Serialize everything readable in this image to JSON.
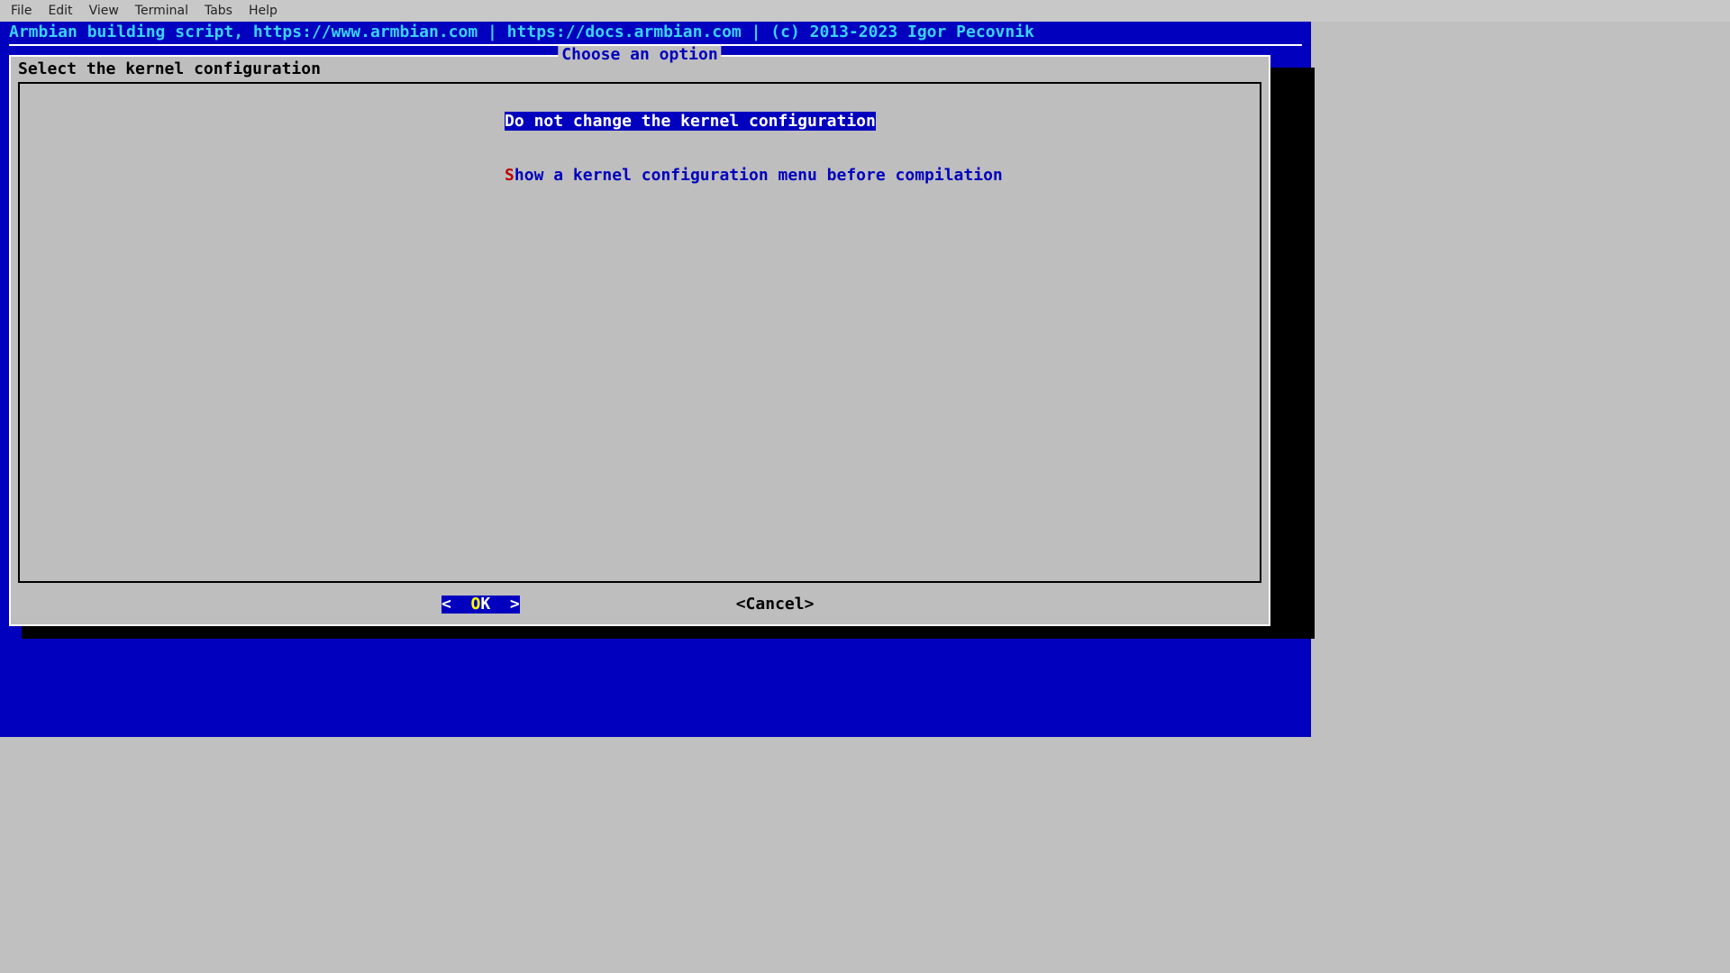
{
  "menubar": {
    "items": [
      "File",
      "Edit",
      "View",
      "Terminal",
      "Tabs",
      "Help"
    ]
  },
  "terminal_header": "Armbian building script, https://www.armbian.com | https://docs.armbian.com | (c) 2013-2023 Igor Pecovnik",
  "dialog": {
    "title": "Choose an option",
    "prompt": "Select the kernel configuration",
    "options": [
      {
        "hotkey": "D",
        "label": "o not change the kernel configuration",
        "selected": true
      },
      {
        "hotkey": "S",
        "label": "how a kernel configuration menu before compilation",
        "selected": false
      }
    ],
    "buttons": {
      "ok_prefix": "<  ",
      "ok_hot": "O",
      "ok_rest": "K  >",
      "cancel": "<Cancel>"
    }
  }
}
